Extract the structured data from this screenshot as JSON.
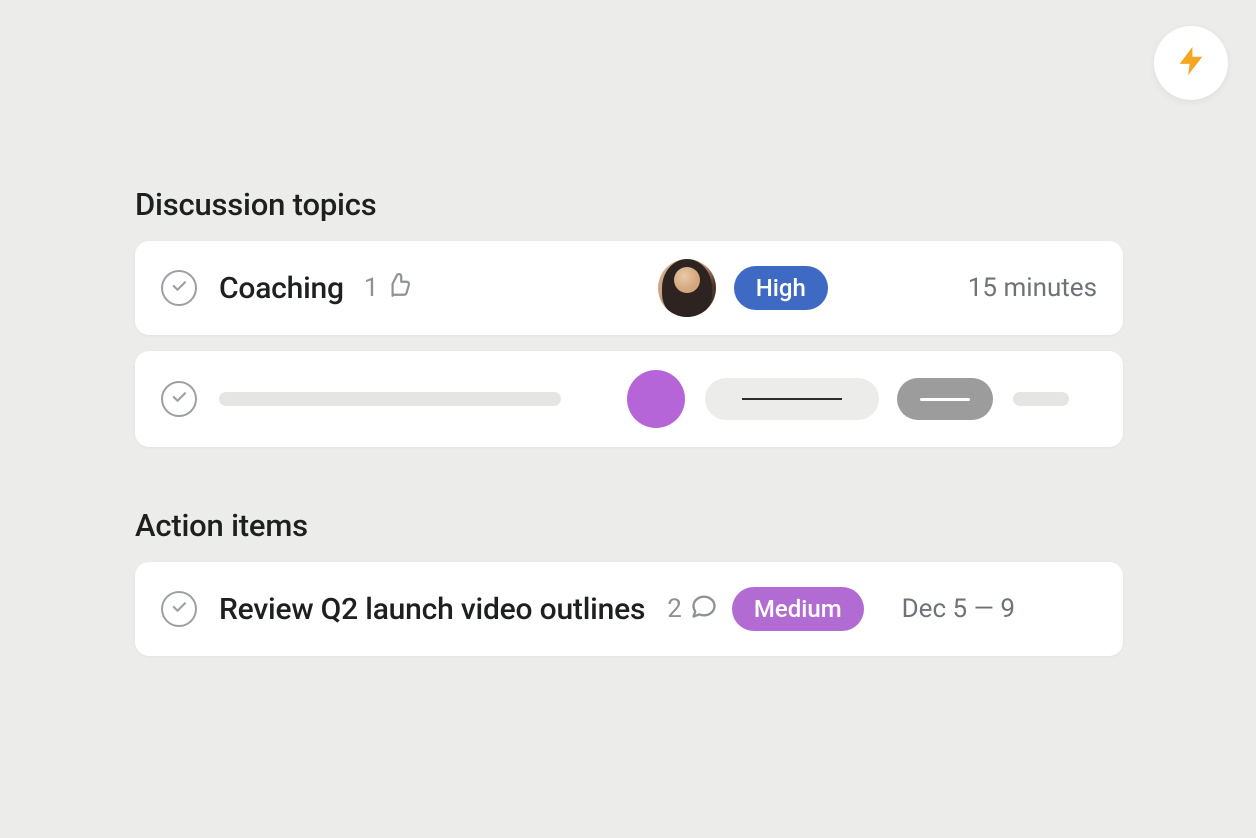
{
  "lightning_button": {
    "icon_name": "lightning-bolt-icon",
    "color": "#f5a623"
  },
  "sections": {
    "discussion": {
      "title": "Discussion topics",
      "items": [
        {
          "title": "Coaching",
          "likes": "1",
          "assignee": "user-avatar",
          "priority": "High",
          "priority_color": "#3f6ac4",
          "duration": "15 minutes"
        },
        {
          "placeholder": true,
          "avatar_color": "#b565d8"
        }
      ]
    },
    "action_items": {
      "title": "Action items",
      "items": [
        {
          "title": "Review Q2 launch video outlines",
          "comments": "2",
          "priority": "Medium",
          "priority_color": "#b36bd4",
          "date_range": "Dec 5 — 9"
        }
      ]
    }
  }
}
